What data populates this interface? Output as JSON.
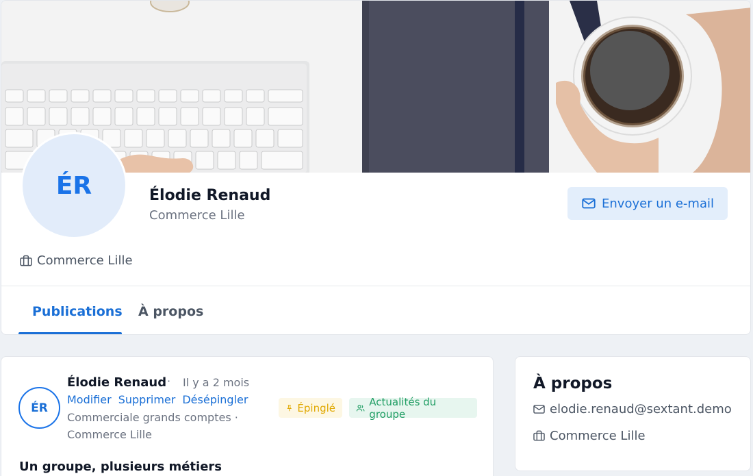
{
  "profile": {
    "initials": "ÉR",
    "name": "Élodie Renaud",
    "department": "Commerce Lille",
    "organization": "Commerce Lille",
    "email_button_label": "Envoyer un e-mail"
  },
  "tabs": [
    {
      "label": "Publications",
      "active": true
    },
    {
      "label": "À propos",
      "active": false
    }
  ],
  "post": {
    "author_initials": "ÉR",
    "author": "Élodie Renaud",
    "separator": "·",
    "time": "Il y a 2 mois",
    "actions": [
      "Modifier",
      "Supprimer",
      "Désépingler"
    ],
    "role_line": "Commerciale grands comptes ·",
    "org_line": "Commerce Lille",
    "badges": {
      "pinned": "Épinglé",
      "group": "Actualités du groupe"
    },
    "title": "Un groupe, plusieurs métiers"
  },
  "about": {
    "title": "À propos",
    "email": "elodie.renaud@sextant.demo",
    "organization": "Commerce Lille"
  },
  "colors": {
    "accent": "#1a6fd6",
    "pinned": "#e0a800",
    "group": "#1f9d63",
    "background": "#eef1f5"
  }
}
